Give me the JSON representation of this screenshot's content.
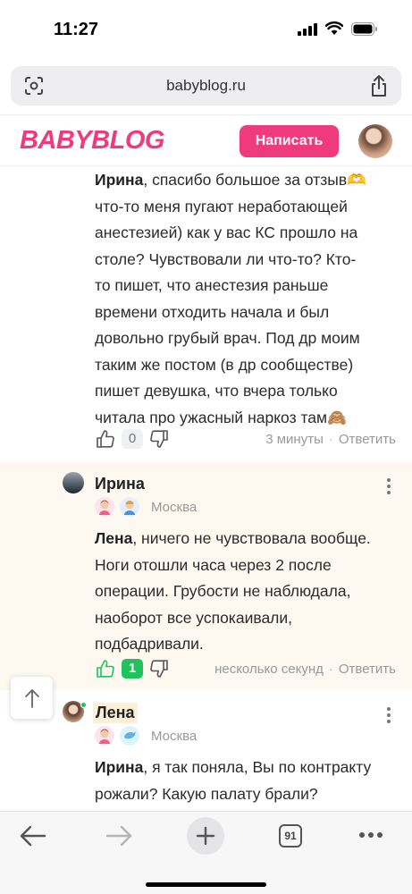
{
  "status_bar": {
    "time": "11:27"
  },
  "browser": {
    "url": "babyblog.ru",
    "tab_count": "91"
  },
  "header": {
    "logo": "BABYBLOG",
    "write_button": "Написать"
  },
  "comments": [
    {
      "addressee": "Ирина",
      "lines": [
        "спасибо большое за отзыв🫶",
        "что-то меня пугают неработающей",
        "анестезией) как у вас КС прошло на",
        "столе? Чувствовали ли что-то? Кто-",
        "то пишет, что анестезия раньше",
        "времени отходить начала и был",
        "довольно грубый врач. Под др моим",
        "таким же постом (в др сообществе)",
        "пишет девушка, что вчера только",
        "читала про ужасный наркоз там🙈"
      ],
      "likes": "0",
      "time": "3 минуты",
      "reply": "Ответить"
    },
    {
      "author": "Ирина",
      "location": "Москва",
      "addressee": "Лена",
      "lines": [
        ", ничего не чувствовала вообще.",
        "Ноги отошли часа через 2 после",
        "операции. Грубости не наблюдала,",
        "наоборот все успокаивали,",
        "подбадривали."
      ],
      "likes": "1",
      "time": "несколько секунд",
      "reply": "Ответить"
    },
    {
      "author": "Лена",
      "location": "Москва",
      "addressee": "Ирина",
      "lines": [
        ", я так поняла, Вы по контракту",
        "рожали? Какую палату брали?"
      ]
    }
  ],
  "colors": {
    "brand": "#ef3b7d",
    "like_active": "#21c25e",
    "highlight_bg": "#fdf8f0"
  }
}
